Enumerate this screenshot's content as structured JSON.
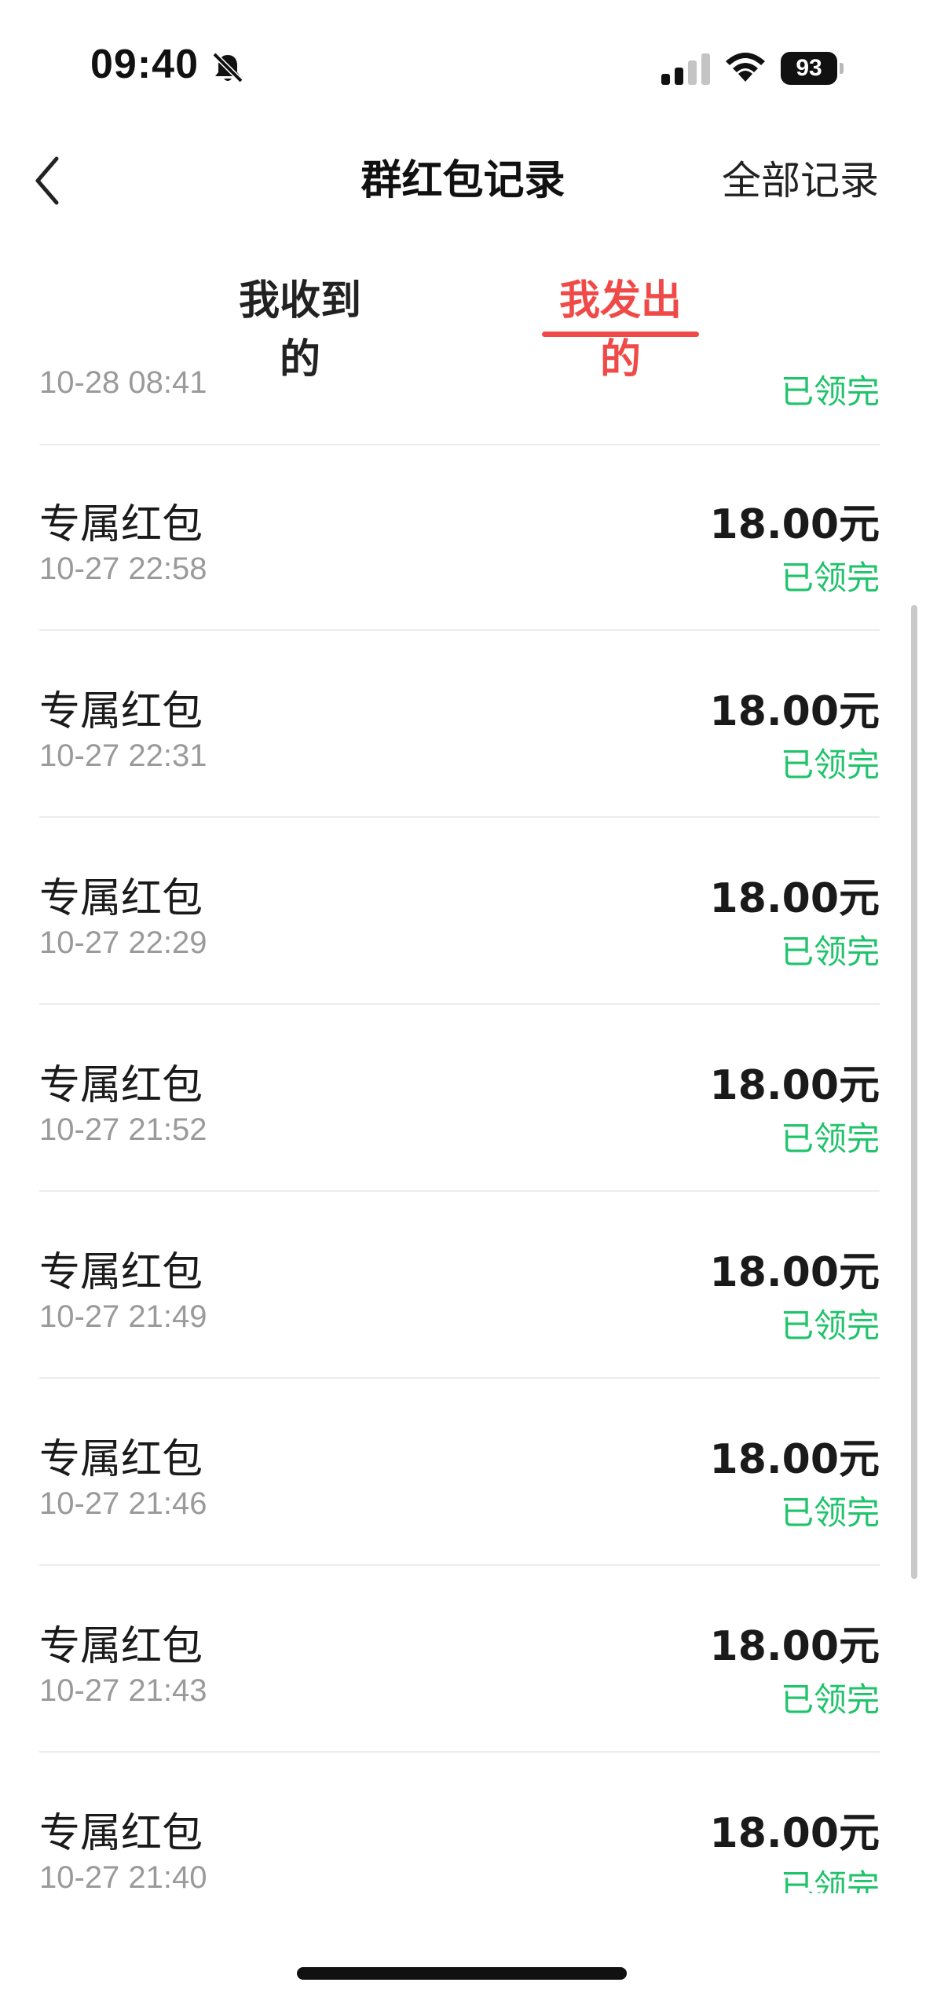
{
  "status_bar": {
    "time": "09:40",
    "battery": "93",
    "icons": [
      "bell-slash-icon",
      "signal-icon",
      "wifi-icon",
      "battery-icon"
    ]
  },
  "nav": {
    "back_icon": "chevron-left-icon",
    "title": "群红包记录",
    "right_action": "全部记录"
  },
  "tabs": [
    {
      "label": "我收到的",
      "active": false
    },
    {
      "label": "我发出的",
      "active": true
    }
  ],
  "colors": {
    "accent": "#f04a48",
    "status_green": "#1fc36a",
    "secondary_text": "#9a9a9a"
  },
  "partial_item": {
    "time": "10-28 08:41",
    "status": "已领完"
  },
  "records": [
    {
      "title": "专属红包",
      "time": "10-27 22:58",
      "amount": "18.00元",
      "status": "已领完"
    },
    {
      "title": "专属红包",
      "time": "10-27 22:31",
      "amount": "18.00元",
      "status": "已领完"
    },
    {
      "title": "专属红包",
      "time": "10-27 22:29",
      "amount": "18.00元",
      "status": "已领完"
    },
    {
      "title": "专属红包",
      "time": "10-27 21:52",
      "amount": "18.00元",
      "status": "已领完"
    },
    {
      "title": "专属红包",
      "time": "10-27 21:49",
      "amount": "18.00元",
      "status": "已领完"
    },
    {
      "title": "专属红包",
      "time": "10-27 21:46",
      "amount": "18.00元",
      "status": "已领完"
    },
    {
      "title": "专属红包",
      "time": "10-27 21:43",
      "amount": "18.00元",
      "status": "已领完"
    },
    {
      "title": "专属红包",
      "time": "10-27 21:40",
      "amount": "18.00元",
      "status": "已领完"
    }
  ]
}
